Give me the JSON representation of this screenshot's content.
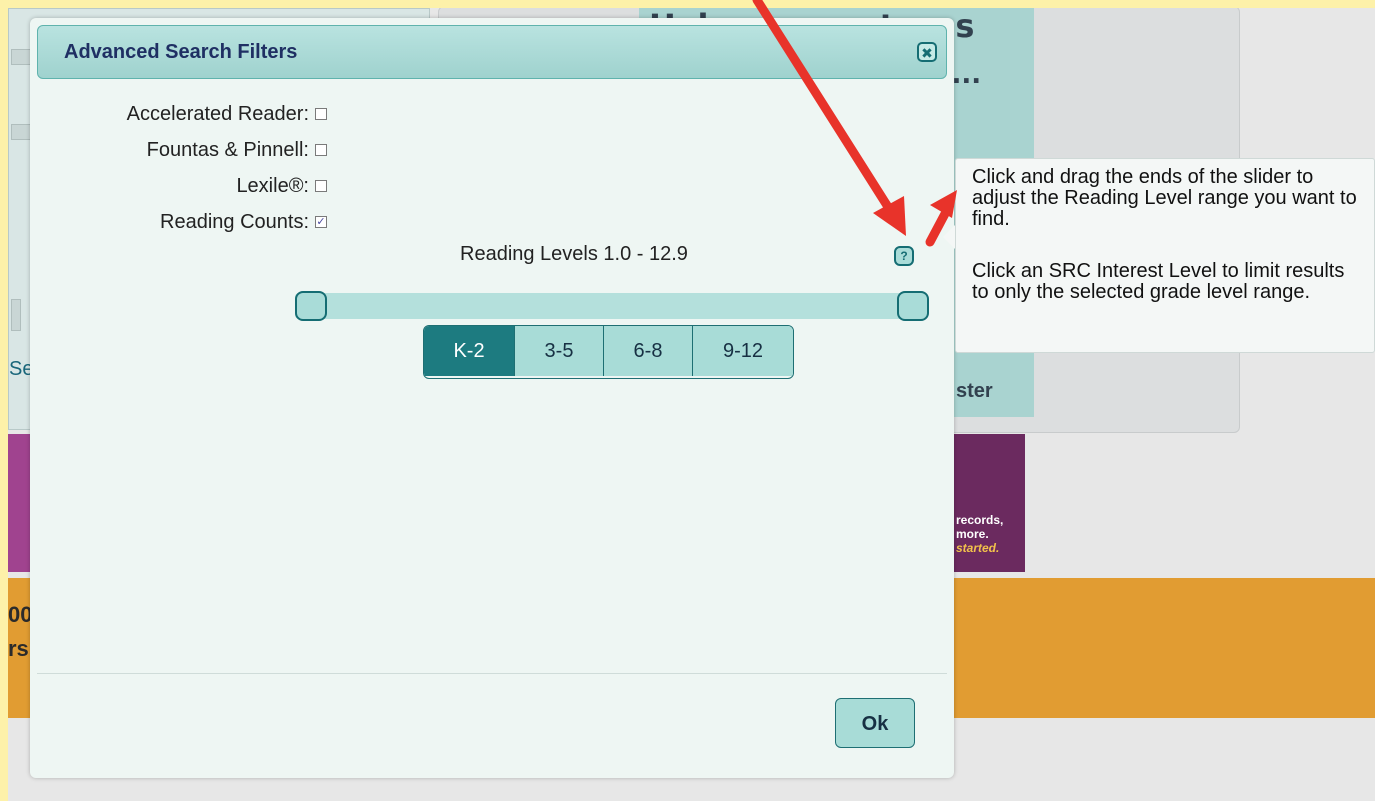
{
  "background": {
    "headline": "Help your patrons",
    "subline": "n...",
    "se_text": "Se",
    "ster_text": "ster",
    "purple_lines": [
      "records,",
      "more.",
      "started."
    ],
    "orange_lines": [
      "00",
      "rs"
    ]
  },
  "dialog": {
    "title": "Advanced Search Filters",
    "close_symbol": "✖",
    "filters": [
      {
        "label": "Accelerated Reader:",
        "checked": false
      },
      {
        "label": "Fountas & Pinnell:",
        "checked": false
      },
      {
        "label": "Lexile®:",
        "checked": false
      },
      {
        "label": "Reading Counts:",
        "checked": true
      }
    ],
    "reading_levels_label": "Reading Levels 1.0 - 12.9",
    "help_symbol": "?",
    "slider": {
      "min": 1.0,
      "max": 12.9,
      "low": 1.0,
      "high": 12.9
    },
    "grade_buttons": [
      {
        "label": "K-2",
        "active": true
      },
      {
        "label": "3-5",
        "active": false
      },
      {
        "label": "6-8",
        "active": false
      },
      {
        "label": "9-12",
        "active": false
      }
    ],
    "ok_label": "Ok"
  },
  "tooltip": {
    "paragraph1": "Click and drag the ends of the slider to adjust the Reading Level range you want to find.",
    "paragraph2": "Click an SRC Interest Level to limit results to only the selected grade level range."
  },
  "colors": {
    "frame": "#fdf1a9",
    "accent": "#1d7b80",
    "annotation_arrow": "#e8332a"
  }
}
